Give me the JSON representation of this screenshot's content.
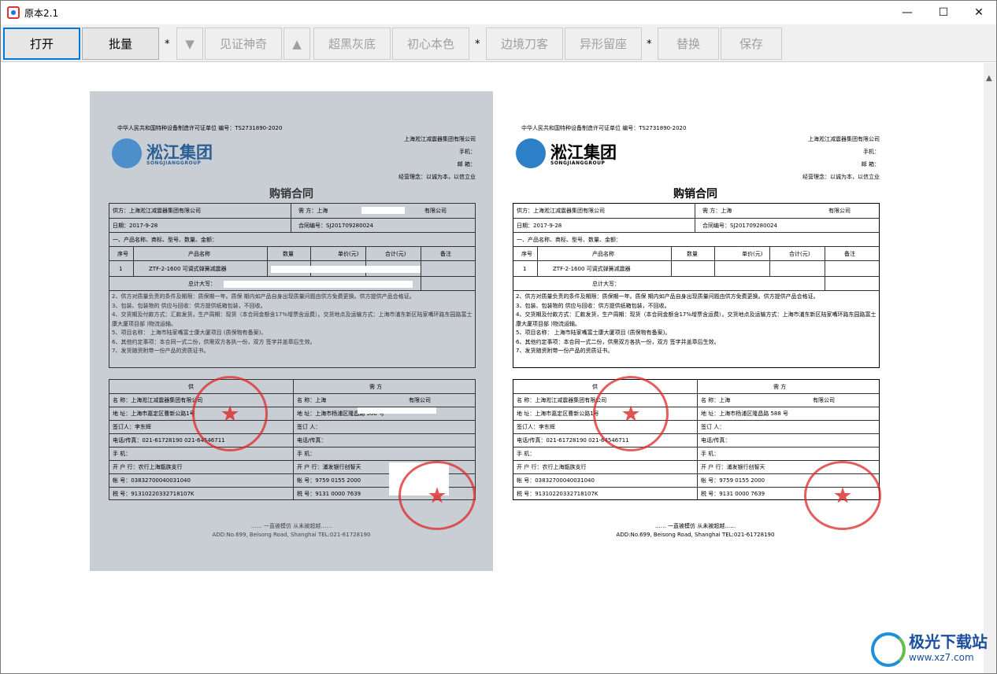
{
  "window": {
    "title": "原本2.1",
    "minimize_glyph": "—",
    "maximize_glyph": "☐",
    "close_glyph": "✕"
  },
  "toolbar": {
    "open_label": "打开",
    "batch_label": "批量",
    "sep_glyph": "*",
    "down_glyph": "▼",
    "witness_label": "见证神奇",
    "up_glyph": "▲",
    "superblack_label": "超黑灰底",
    "original_color_label": "初心本色",
    "border_blade_label": "边境刀客",
    "shaped_seat_label": "异形留座",
    "replace_label": "替换",
    "save_label": "保存"
  },
  "scrollbar": {
    "up_glyph": "▲"
  },
  "document": {
    "license_line": "中华人民共和国特种设备制造许可证单位  编号：TS2731890-2020",
    "company_right": "上海淞江减震器集团有限公司",
    "phone_label": "手机：",
    "email_label": "邮 箱：",
    "motto": "经营理念：以诚为本，以信立业",
    "logo_name": "淞江集团",
    "logo_sub": "SONGJIANGGROUP",
    "title": "购销合同",
    "supplier_row": "供方：上海淞江减震器集团有限公司",
    "buyer_row": "需        方：上海",
    "buyer_suffix": "有限公司",
    "date_row": "日期：2017-9-28",
    "contract_no": "合同编号：SJ201709280024",
    "section1": "一、产品名称、商标、型号、数量、金额：",
    "col_no": "序号",
    "col_name": "产品名称",
    "col_qty": "数量",
    "col_price": "单价(元)",
    "col_total": "合计(元)",
    "col_note": "备注",
    "item_no": "1",
    "item_name": "ZTF-2-1600 可调式弹簧减震器",
    "total_caps": "总计大写：",
    "clause2": "2、供方对质量负责的条件及期限：质保期一年。质保  期内如产品自身出现质量问题由供方免费更换。供方提供产品合格证。",
    "clause3": "3、包装、包装物的  供应与回收：供方提供纸箱包装，不回收。",
    "clause4": "4、交货期及付款方式：汇款发货，生产周期：现货（本合同金额含17%增票含运费）。交货地点及运输方式：上海市浦东新区陆家嘴环路东园路富士康大厦项目部           )物流运输。",
    "clause5": "5、项目名称：        上海市陆家嘴富士康大厦项目                (质保物有备案)。",
    "clause6": "6、其他约定事项：本合同一式二份，供需双方各执一份，双方  签字并盖章后生效。",
    "clause7": "7、发货随资附带一份产品的资质证书。",
    "supply_header": "供",
    "demand_header": "需        方",
    "s_name": "名 称：上海淞江减震器集团有限公司",
    "s_addr": "地 址：上海市嘉定区曹新公路1号",
    "s_sign": "签订人：李东辉",
    "s_tel": "电话/传真：021-61728190    021-64546711",
    "s_mobile": "手    机：",
    "s_bank": "开 户 行：农行上海甑族支行",
    "s_acct": "帐    号：03832700040031040",
    "s_tax": "税    号：91310220332718107K",
    "d_name": "名    称：上海",
    "d_name_suffix": "有限公司",
    "d_addr": "地 址：上海市杨浦区隆昌路 588 号",
    "d_sign": "签订 人：",
    "d_tel": "电话/传真：",
    "d_mobile": "手    机：",
    "d_bank": "开 户 行：浦发银行创智天",
    "d_acct": "帐    号：9759 0155 2000",
    "d_tax": "税    号：9131 0000 7639",
    "footer_slogan": "……  一直被模仿  从未被超越……",
    "footer_addr": "ADD:No.699, Beisong Road, Shanghai      TEL:021-61728190"
  },
  "watermark": {
    "name": "极光下载站",
    "url": "www.xz7.com"
  },
  "colors": {
    "accent_border": "#0078d7",
    "disabled_text": "#a0a0a0",
    "stamp_red": "#dc2828",
    "logo_blue": "#2d7fc8"
  }
}
